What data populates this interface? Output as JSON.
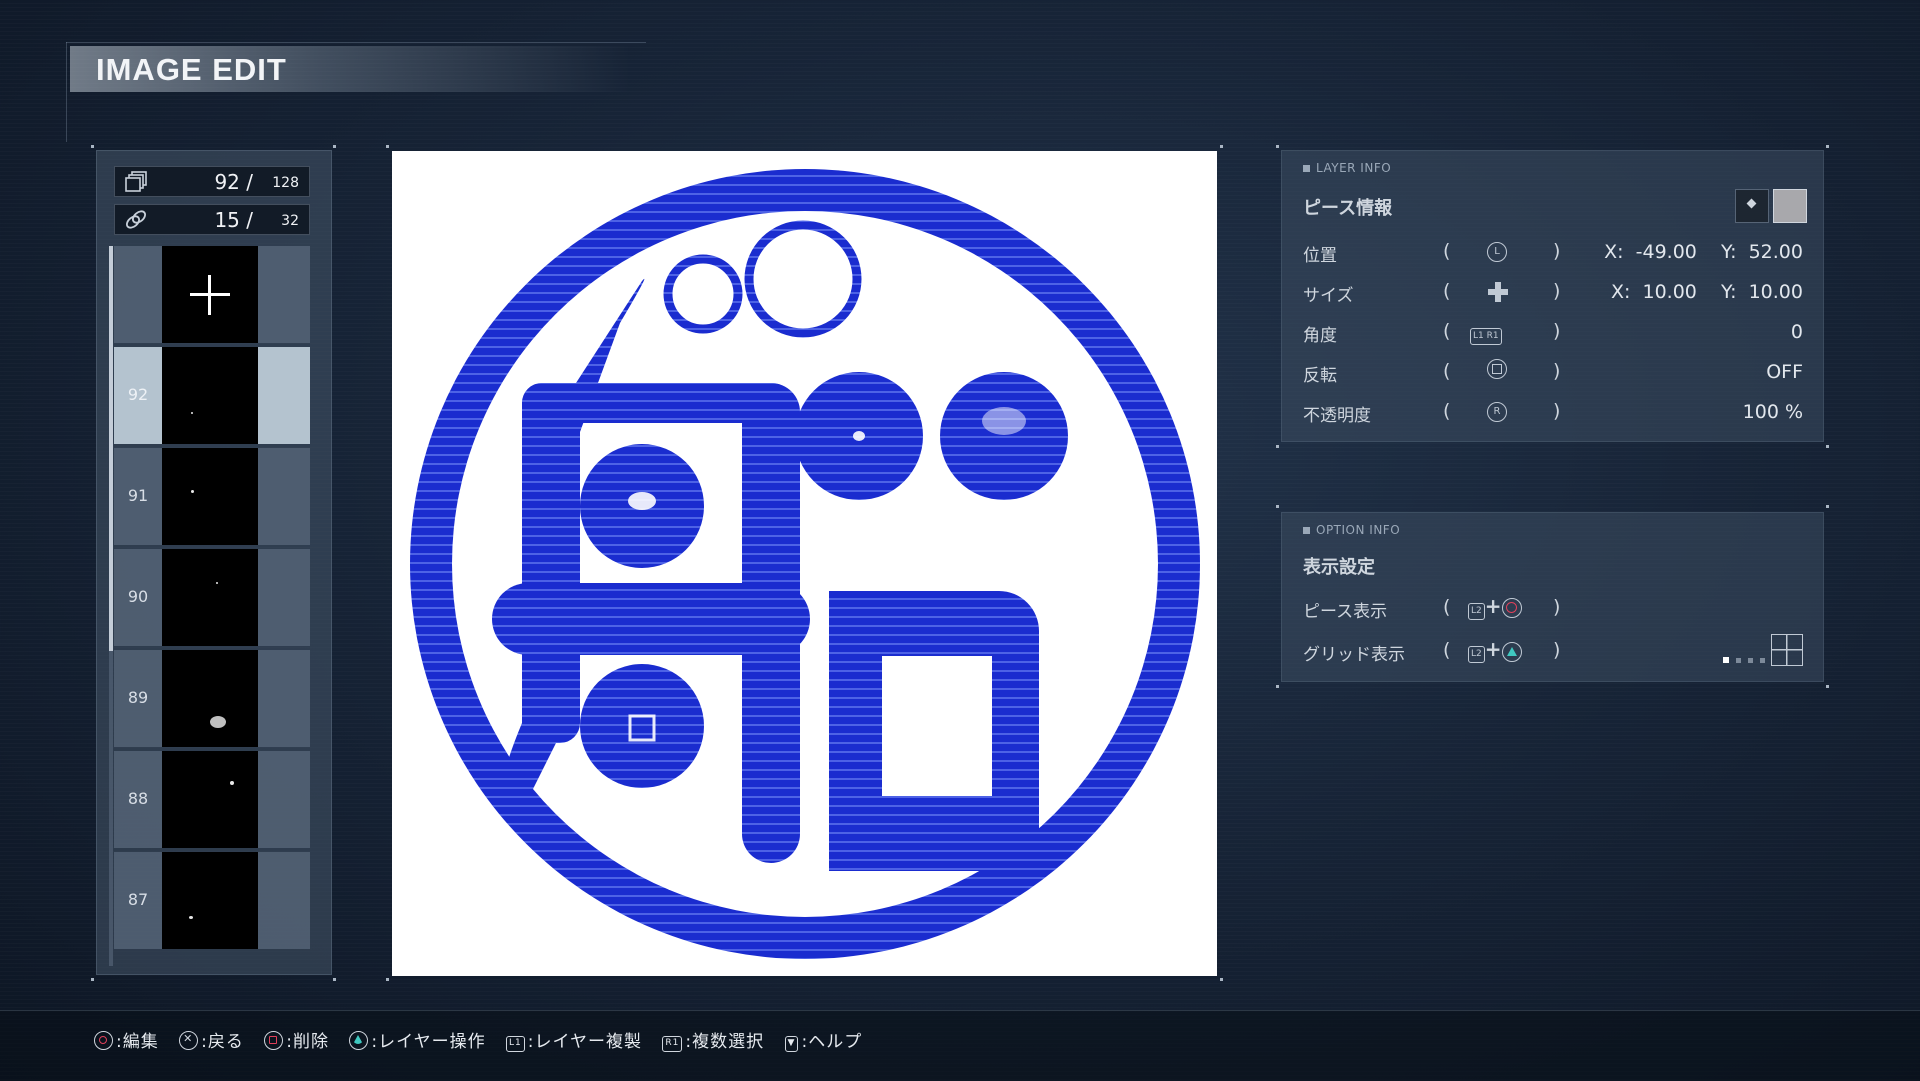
{
  "title": "IMAGE EDIT",
  "layer_panel": {
    "pieces_count": "92",
    "pieces_separator": "/",
    "pieces_max": "128",
    "links_count": "15",
    "links_separator": "/",
    "links_max": "32",
    "pieces_icon": "stacked-layers-icon",
    "links_icon": "chain-link-icon",
    "rows": [
      {
        "label": "",
        "type": "add"
      },
      {
        "label": "92",
        "type": "layer",
        "selected": true
      },
      {
        "label": "91",
        "type": "layer"
      },
      {
        "label": "90",
        "type": "layer"
      },
      {
        "label": "89",
        "type": "layer"
      },
      {
        "label": "88",
        "type": "layer"
      },
      {
        "label": "87",
        "type": "layer"
      }
    ]
  },
  "canvas": {
    "emblem_color": "#1a2ccf",
    "background": "#ffffff"
  },
  "layer_info": {
    "tag": "LAYER INFO",
    "title": "ピース情報",
    "rows": [
      {
        "label": "位置",
        "button": "L",
        "value": "X:  -49.00    Y:  52.00"
      },
      {
        "label": "サイズ",
        "button": "dpad",
        "value": "X:  10.00    Y:  10.00"
      },
      {
        "label": "角度",
        "button": "L1 R1",
        "value": "0"
      },
      {
        "label": "反転",
        "button": "square",
        "value": "OFF"
      },
      {
        "label": "不透明度",
        "button": "R",
        "value": "100 %"
      }
    ]
  },
  "option_info": {
    "tag": "OPTION INFO",
    "title": "表示設定",
    "rows": [
      {
        "label": "ピース表示",
        "button": "L2 + circle"
      },
      {
        "label": "グリッド表示",
        "button": "L2 + triangle"
      }
    ]
  },
  "footer": {
    "hints": [
      {
        "button": "circle",
        "label": ":編集"
      },
      {
        "button": "cross",
        "label": ":戻る"
      },
      {
        "button": "square",
        "label": ":削除"
      },
      {
        "button": "triangle",
        "label": ":レイヤー操作"
      },
      {
        "button": "L1",
        "label": ":レイヤー複製"
      },
      {
        "button": "R1",
        "label": ":複数選択"
      },
      {
        "button": "touchpad",
        "label": ":ヘルプ"
      }
    ]
  },
  "colors": {
    "accent_circle": "#e0405a",
    "accent_triangle": "#40c8c0",
    "selected_row": "#b4c3cf"
  }
}
